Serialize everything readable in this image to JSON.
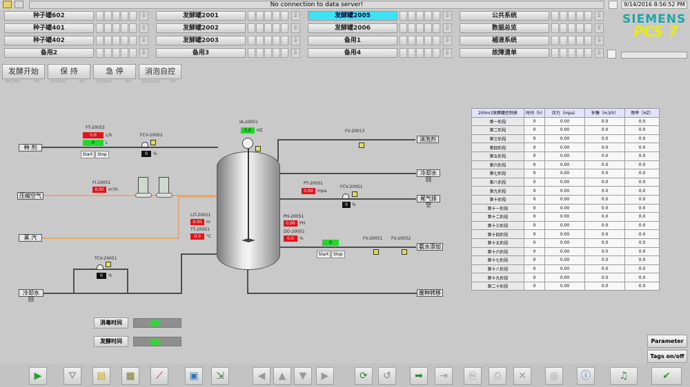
{
  "top": {
    "message": "No connection to data server!",
    "datetime": "9/14/2016 8:56:52 PM"
  },
  "brand": {
    "company": "SIEMENS",
    "product": "PCS 7",
    "color_company": "#1aa7a7",
    "color_product": "#e8f000"
  },
  "nav": {
    "col1": [
      "种子罐602",
      "种子罐401",
      "种子罐402",
      "备用2"
    ],
    "col2": [
      "发酵罐2001",
      "发酵罐2002",
      "发酵罐2003",
      "备用3"
    ],
    "col3": [
      "发酵罐2005",
      "发酵罐2006",
      "备用1",
      "备用4"
    ],
    "col4": [
      "公共系统",
      "数据总览",
      "補液系统",
      "故障清单"
    ],
    "active": "发酵罐2005"
  },
  "commands": [
    {
      "label": "发酵开始",
      "sub1": "SFC2001",
      "sub2": "SFC"
    },
    {
      "label": "保 持",
      "sub1": "DF20502",
      "sub2": "SFC"
    },
    {
      "label": "急 停",
      "sub1": "DF20503",
      "sub2": "SFC"
    },
    {
      "label": "消泡自控",
      "sub1": "pH/control",
      "sub2": "SFC"
    }
  ],
  "process": {
    "ft_tag": "FT-20053",
    "ft_val1": "0.0",
    "ft_unit1": "L/h",
    "ft_val2": "0",
    "ft_unit2": "L",
    "start": "Start",
    "stop": "Stop",
    "fcv1_tag": "FCV-20052",
    "fcv1_val": "0",
    "pct": "%",
    "seed_label": "种 剂",
    "air_label": "压缩空气",
    "steam_label": "蒸 汽",
    "cool_label": "冷却水回",
    "fi_tag": "FI-20051",
    "fi_val": "0.00",
    "fi_unit": "m³/h",
    "ia_tag": "IA-20051",
    "ia_val": "0.0",
    "ia_unit": "HZ",
    "fv_tag": "FV-20013",
    "defoam_label": "消泡剂",
    "cool_add_label": "冷却水回",
    "pt_tag": "PT-20051",
    "pt_val": "0.00",
    "pt_unit": "mpa",
    "fcv2_tag": "FCV-20051",
    "fcv2_val": "0",
    "exhaust_label": "尾气排空",
    "lit_tag": "LIT-20011",
    "lit_val": "0.00",
    "lit_unit": "m",
    "tt_tag": "TT-20051",
    "tt_val": "0.0",
    "tt_unit": "°C",
    "ph_tag": "PH-20051",
    "ph_val": "0.00",
    "ph_unit": "PH",
    "do_tag": "DO-20051",
    "do_val": "0.0",
    "do_unit": "%",
    "green_val": "0",
    "fv2_tag": "FV-20051",
    "fv3_tag": "FV-20052",
    "supplement_label": "氨水添加",
    "tcv_tag": "TCV-20051",
    "tcv_val": "0",
    "transfer_label": "废种转移",
    "cool_in_label": "冷却水供",
    "sterilize_label": "消毒时间",
    "ferment_label": "发酵时间"
  },
  "table": {
    "headers": [
      "200m3发酵罐控制表",
      "时间（h）",
      "压力（mpa）",
      "补糖（m3/h）",
      "频率（HZ）"
    ],
    "rows": [
      [
        "第一阶段",
        "0",
        "0.00",
        "0.0",
        "0.0"
      ],
      [
        "第二阶段",
        "0",
        "0.00",
        "0.0",
        "0.0"
      ],
      [
        "第三阶段",
        "0",
        "0.00",
        "0.0",
        "0.0"
      ],
      [
        "第四阶段",
        "0",
        "0.00",
        "0.0",
        "0.0"
      ],
      [
        "第五阶段",
        "0",
        "0.00",
        "0.0",
        "0.0"
      ],
      [
        "第六阶段",
        "0",
        "0.00",
        "0.0",
        "0.0"
      ],
      [
        "第七阶段",
        "0",
        "0.00",
        "0.0",
        "0.0"
      ],
      [
        "第八阶段",
        "0",
        "0.00",
        "0.0",
        "0.0"
      ],
      [
        "第九阶段",
        "0",
        "0.00",
        "0.0",
        "0.0"
      ],
      [
        "第十阶段",
        "0",
        "0.00",
        "0.0",
        "0.0"
      ],
      [
        "第十一阶段",
        "0",
        "0.00",
        "0.0",
        "0.0"
      ],
      [
        "第十二阶段",
        "0",
        "0.00",
        "0.0",
        "0.0"
      ],
      [
        "第十三阶段",
        "0",
        "0.00",
        "0.0",
        "0.0"
      ],
      [
        "第十四阶段",
        "0",
        "0.00",
        "0.0",
        "0.0"
      ],
      [
        "第十五阶段",
        "0",
        "0.00",
        "0.0",
        "0.0"
      ],
      [
        "第十六阶段",
        "0",
        "0.00",
        "0.0",
        "0.0"
      ],
      [
        "第十七阶段",
        "0",
        "0.00",
        "0.0",
        "0.0"
      ],
      [
        "第十八阶段",
        "0",
        "0.00",
        "0.0",
        "0.0"
      ],
      [
        "第十九阶段",
        "0",
        "0.00",
        "0.0",
        "0.0"
      ],
      [
        "第二十阶段",
        "0",
        "0.00",
        "0.0",
        "0.0"
      ]
    ]
  },
  "side": {
    "parameter": "Parameter",
    "tags": "Tags on/off"
  }
}
